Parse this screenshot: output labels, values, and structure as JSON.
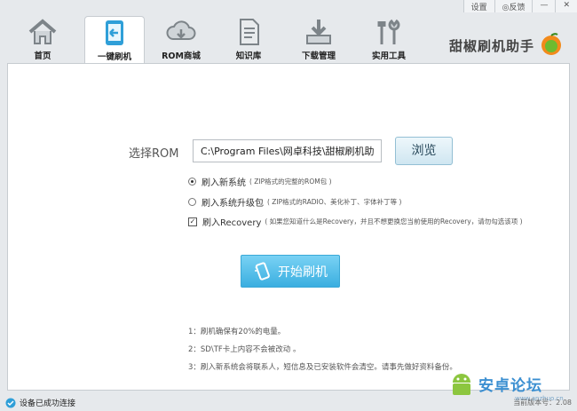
{
  "topbar": {
    "settings": "设置",
    "feedback": "反馈"
  },
  "tabs": [
    {
      "label": "首页",
      "icon": "home-icon"
    },
    {
      "label": "一键刷机",
      "icon": "flash-phone-icon"
    },
    {
      "label": "ROM商城",
      "icon": "cloud-download-icon"
    },
    {
      "label": "知识库",
      "icon": "document-icon"
    },
    {
      "label": "下载管理",
      "icon": "download-tray-icon"
    },
    {
      "label": "实用工具",
      "icon": "tools-icon"
    }
  ],
  "brand": {
    "name": "甜椒刷机助手"
  },
  "flash": {
    "rom_label": "选择ROM",
    "rom_path": "C:\\Program Files\\网卓科技\\甜椒刷机助手\\dov",
    "browse_label": "浏览",
    "options": [
      {
        "label": "刷入新系统",
        "hint": "( ZIP格式的完整的ROM包 )",
        "type": "radio",
        "checked": true
      },
      {
        "label": "刷入系统升级包",
        "hint": "( ZIP格式的RADIO、美化补丁、字体补丁等 )",
        "type": "radio",
        "checked": false
      },
      {
        "label": "刷入Recovery",
        "hint": "( 如果您知道什么是Recovery，并且不想更换您当前使用的Recovery，请勿勾选该项 )",
        "type": "checkbox",
        "checked": true
      }
    ],
    "start_label": "开始刷机"
  },
  "tips": [
    "1：刷机确保有20%的电量。",
    "2：SD\\TF卡上内容不会被改动 。",
    "3：刷入新系统会将联系人，短信息及已安装软件会清空。请事先做好资料备份。"
  ],
  "status": {
    "connection": "设备已成功连接",
    "version": "当前版本号：2.08"
  },
  "watermark": {
    "text": "安卓论坛",
    "url": "www.anzhuo.cn"
  },
  "colors": {
    "accent": "#3aaee0",
    "panel_bg": "#ffffff",
    "window_bg": "#e6e9ec"
  }
}
